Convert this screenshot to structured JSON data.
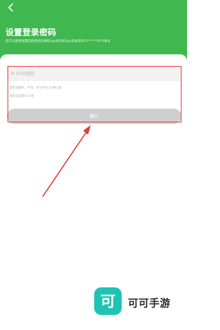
{
  "header": {
    "title": "设置登录密码",
    "description": "您可以使用设置的新密码在乘客App和司机App登录您的157*****875账号",
    "background_color": "#40b84f",
    "back_icon": "back-arrow-icon"
  },
  "form": {
    "password_placeholder": "8-16位密码",
    "hint_line1": "需包含数字、字母、符号中至少2种元素",
    "hint_line2": "密码长度需8-16位",
    "confirm_label": "确认"
  },
  "annotation": {
    "color": "#e53935"
  },
  "watermark": {
    "logo_glyph": "可",
    "text": "可可手游",
    "color": "#1dc4b4"
  }
}
